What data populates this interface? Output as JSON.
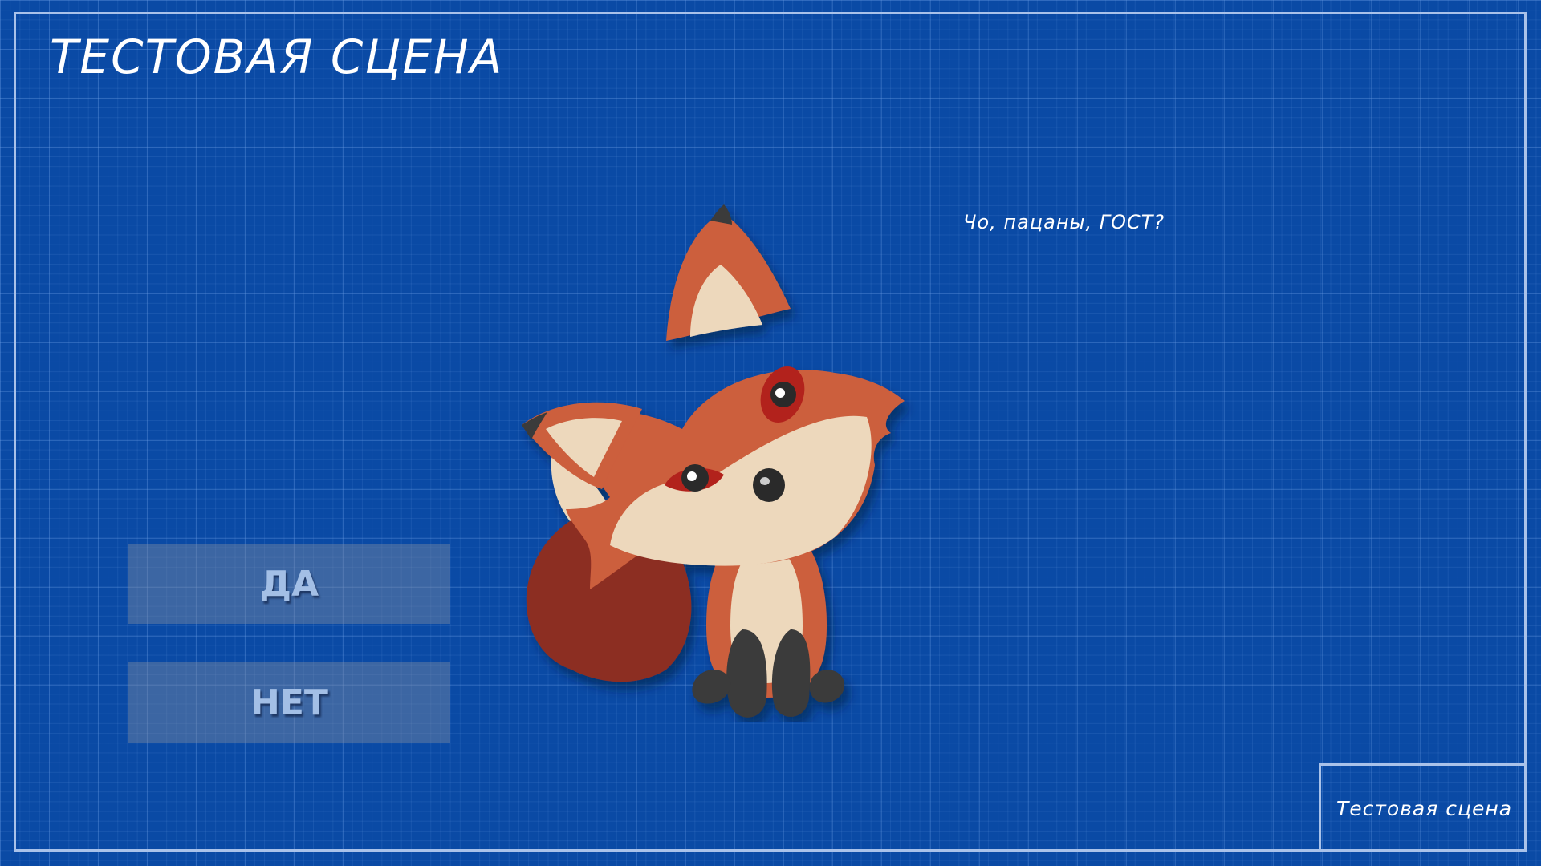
{
  "scene": {
    "title": "ТЕСТОВАЯ СЦЕНА",
    "speech": "Чо, пацаны, ГОСТ?",
    "stamp_label": "Тестовая сцена"
  },
  "choices": {
    "yes_label": "ДА",
    "no_label": "НЕТ"
  },
  "colors": {
    "background": "#0a4aa5",
    "frame": "#a9c2ea",
    "fox_fur": "#cc5e3e",
    "fox_dark_fur": "#8c2e22",
    "fox_cream": "#edd8bc",
    "button_text": "#a3bfe6"
  },
  "character": {
    "icon": "fox-character"
  }
}
